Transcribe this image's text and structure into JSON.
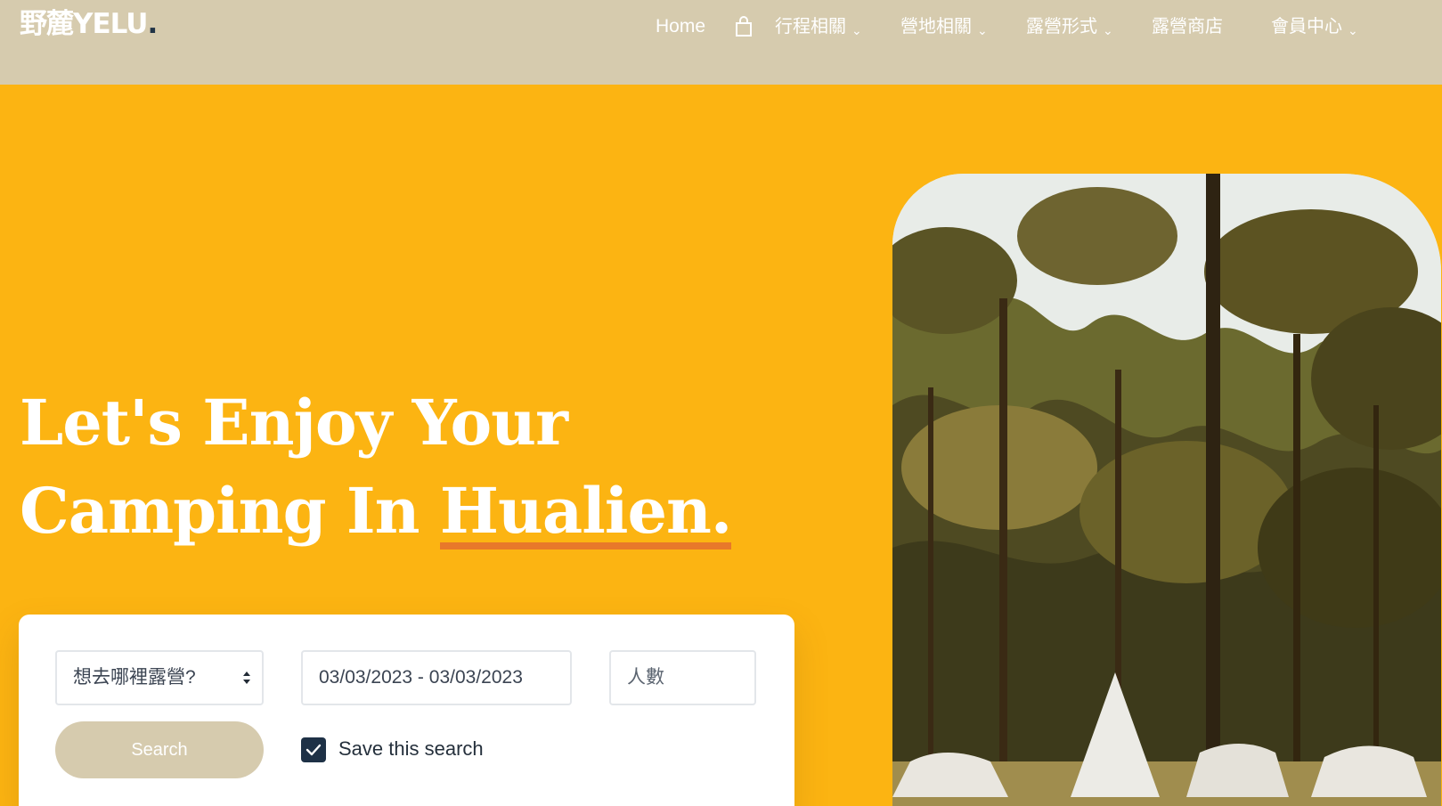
{
  "brand": {
    "logo_text": "野麓YELU",
    "logo_dot": "."
  },
  "nav": {
    "home": "Home",
    "cart_icon": "shopping-bag-icon",
    "trip": "行程相關",
    "campsite": "營地相關",
    "camp_style": "露營形式",
    "shop": "露營商店",
    "member": "會員中心",
    "dropdown_icon": "chevron-down-icon"
  },
  "hero": {
    "line1": "Let's Enjoy Your",
    "line2_prefix": "Camping In ",
    "line2_highlight": "Hualien."
  },
  "search": {
    "location_placeholder": "想去哪裡露營?",
    "dates_value": "03/03/2023 - 03/03/2023",
    "people_placeholder": "人數",
    "button_label": "Search",
    "save_checked": true,
    "save_label": "Save this search"
  },
  "colors": {
    "background": "#fcb412",
    "header": "#d6cbae",
    "underline_accent": "#e8782a",
    "checkbox": "#1e3146"
  },
  "photo": {
    "subject_icon": "camping-forest-photo"
  }
}
